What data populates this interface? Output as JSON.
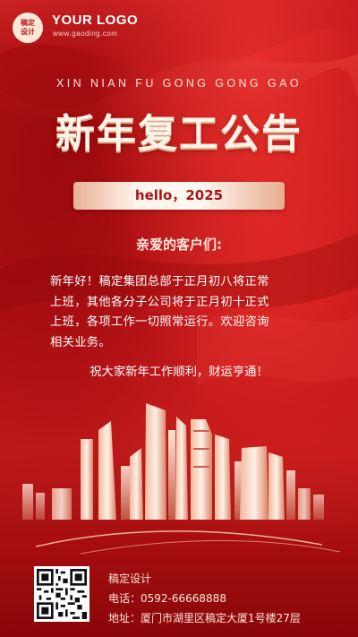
{
  "logo": {
    "badge_line1": "稿定",
    "badge_line2": "设计",
    "text": "YOUR LOGO",
    "url": "www.gaoding.com"
  },
  "header": {
    "pinyin": "XIN NIAN FU GONG GONG GAO",
    "title": "新年复工公告"
  },
  "hello": "hello，2025",
  "greeting": "亲爱的客户们:",
  "body_lines": [
    "新年好！稿定集团总部于正月初八将正常",
    "上班，其他各分子公司将于正月初十正式",
    "上班，各项工作一切照常运行。欢迎咨询",
    "相关业务。"
  ],
  "wish": "祝大家新年工作顺利，财运亨通！",
  "footer": {
    "company": "稿定设计",
    "phone": "电话：0592-66668888",
    "address": "地址：厦门市湖里区稿定大厦1号楼27层"
  },
  "colors": {
    "background": "#b40d10",
    "accent_gold": "#e9b196",
    "text_light": "#ffe6dc"
  }
}
